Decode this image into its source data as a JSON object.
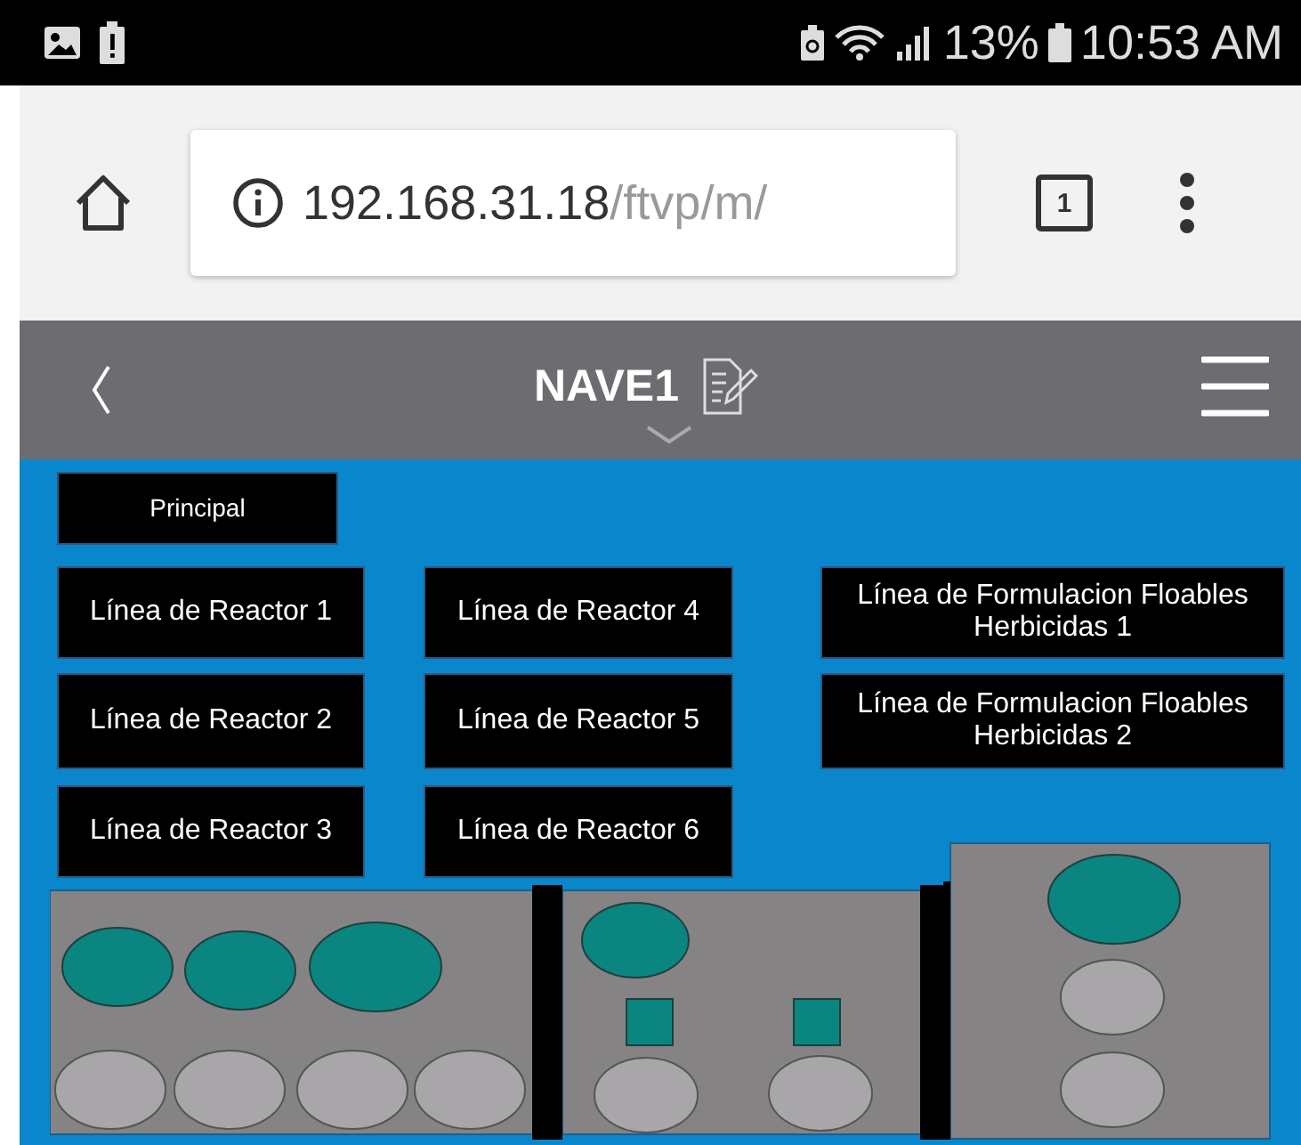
{
  "status_bar": {
    "battery_percent": "13%",
    "time": "10:53 AM"
  },
  "browser": {
    "url_host": "192.168.31.18",
    "url_path": "/ftvp/m/",
    "tab_count": "1"
  },
  "header": {
    "title": "NAVE1"
  },
  "principal_button": "Principal",
  "columns": [
    {
      "buttons": [
        "Línea de Reactor 1",
        "Línea de Reactor 2",
        "Línea de Reactor 3"
      ]
    },
    {
      "buttons": [
        "Línea de Reactor 4",
        "Línea de Reactor 5",
        "Línea de Reactor 6"
      ]
    },
    {
      "buttons": [
        "Línea de Formulacion Floables Herbicidas 1",
        "Línea de Formulacion Floables Herbicidas 2"
      ]
    }
  ]
}
